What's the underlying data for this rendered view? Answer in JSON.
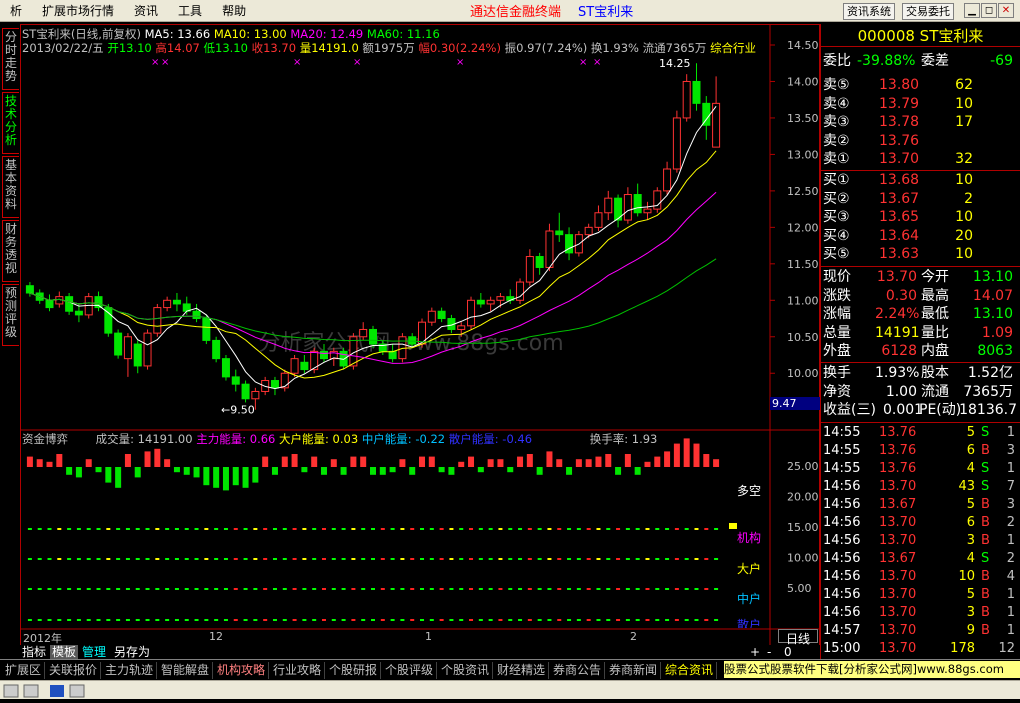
{
  "menu": {
    "items": [
      "析",
      "扩展市场行情",
      "资讯",
      "工具",
      "帮助"
    ],
    "app_title": "通达信金融终端",
    "stock_title": "ST宝利来",
    "btn_news": "资讯系统",
    "btn_trade": "交易委托"
  },
  "left_tabs": [
    "分时走势",
    "技术分析",
    "基本资料",
    "财务透视",
    "预测评级"
  ],
  "chart_header": {
    "name": "ST宝利来(日线,前复权)",
    "ma5": "MA5: 13.66",
    "ma10": "MA10: 13.00",
    "ma20": "MA20: 12.49",
    "ma60": "MA60: 11.16",
    "date": "2013/02/22/五",
    "open": "开13.10",
    "high": "高14.07",
    "low": "低13.10",
    "close": "收13.70",
    "vol": "量14191.0",
    "amount": "额1975万",
    "change": "幅0.30(2.24%)",
    "amplitude": "振0.97(7.24%)",
    "turnover": "换1.93%",
    "float": "流通7365万",
    "industry": "综合行业"
  },
  "price_axis": [
    "14.50",
    "14.00",
    "13.50",
    "13.00",
    "12.50",
    "12.00",
    "11.50",
    "11.00",
    "10.50",
    "10.00"
  ],
  "price_marker": "9.47",
  "annotations": {
    "high": "14.25",
    "low": "9.50"
  },
  "watermark": "分析家公式网 www.88gs.com",
  "lower": {
    "title": "资金博弈",
    "vol": "成交量: 14191.00",
    "main": "主力能量: 0.66",
    "big": "大户能量: 0.03",
    "mid": "中户能量: -0.22",
    "small": "散户能量: -0.46",
    "turnover": "换手率: 1.93",
    "axis": [
      "25.00",
      "20.00",
      "15.00",
      "10.00",
      "5.00"
    ],
    "labels": [
      "多空",
      "机构",
      "大户",
      "中户",
      "散户"
    ]
  },
  "time_axis": [
    "2012年",
    "12",
    "1",
    "2"
  ],
  "period": "日线",
  "sub_tabs": [
    "指标",
    "模板",
    "管理",
    "另存为"
  ],
  "quote": {
    "code_name": "000008 ST宝利来",
    "weibi_label": "委比",
    "weibi": "-39.88%",
    "weicha_label": "委差",
    "weicha": "-69",
    "asks": [
      {
        "label": "卖⑤",
        "price": "13.80",
        "vol": "62"
      },
      {
        "label": "卖④",
        "price": "13.79",
        "vol": "10"
      },
      {
        "label": "卖③",
        "price": "13.78",
        "vol": "17"
      },
      {
        "label": "卖②",
        "price": "13.76",
        "vol": ""
      },
      {
        "label": "卖①",
        "price": "13.70",
        "vol": "32"
      }
    ],
    "bids": [
      {
        "label": "买①",
        "price": "13.68",
        "vol": "10"
      },
      {
        "label": "买②",
        "price": "13.67",
        "vol": "2"
      },
      {
        "label": "买③",
        "price": "13.65",
        "vol": "10"
      },
      {
        "label": "买④",
        "price": "13.64",
        "vol": "20"
      },
      {
        "label": "买⑤",
        "price": "13.63",
        "vol": "10"
      }
    ],
    "stats": [
      {
        "l1": "现价",
        "v1": "13.70",
        "l2": "今开",
        "v2": "13.10"
      },
      {
        "l1": "涨跌",
        "v1": "0.30",
        "l2": "最高",
        "v2": "14.07"
      },
      {
        "l1": "涨幅",
        "v1": "2.24%",
        "l2": "最低",
        "v2": "13.10"
      },
      {
        "l1": "总量",
        "v1": "14191",
        "l2": "量比",
        "v2": "1.09"
      },
      {
        "l1": "外盘",
        "v1": "6128",
        "l2": "内盘",
        "v2": "8063"
      }
    ],
    "stats2": [
      {
        "l1": "换手",
        "v1": "1.93%",
        "l2": "股本",
        "v2": "1.52亿"
      },
      {
        "l1": "净资",
        "v1": "1.00",
        "l2": "流通",
        "v2": "7365万"
      },
      {
        "l1": "收益(三)",
        "v1": "0.001",
        "l2": "PE(动)",
        "v2": "18136.7"
      }
    ],
    "ticks": [
      {
        "t": "14:55",
        "p": "13.76",
        "v": "5",
        "s": "S",
        "n": "1"
      },
      {
        "t": "14:55",
        "p": "13.76",
        "v": "6",
        "s": "B",
        "n": "3"
      },
      {
        "t": "14:55",
        "p": "13.76",
        "v": "4",
        "s": "S",
        "n": "1"
      },
      {
        "t": "14:56",
        "p": "13.70",
        "v": "43",
        "s": "S",
        "n": "7"
      },
      {
        "t": "14:56",
        "p": "13.67",
        "v": "5",
        "s": "B",
        "n": "3"
      },
      {
        "t": "14:56",
        "p": "13.70",
        "v": "6",
        "s": "B",
        "n": "2"
      },
      {
        "t": "14:56",
        "p": "13.70",
        "v": "3",
        "s": "B",
        "n": "1"
      },
      {
        "t": "14:56",
        "p": "13.67",
        "v": "4",
        "s": "S",
        "n": "2"
      },
      {
        "t": "14:56",
        "p": "13.70",
        "v": "10",
        "s": "B",
        "n": "4"
      },
      {
        "t": "14:56",
        "p": "13.70",
        "v": "5",
        "s": "B",
        "n": "1"
      },
      {
        "t": "14:56",
        "p": "13.70",
        "v": "3",
        "s": "B",
        "n": "1"
      },
      {
        "t": "14:57",
        "p": "13.70",
        "v": "9",
        "s": "B",
        "n": "1"
      },
      {
        "t": "15:00",
        "p": "13.70",
        "v": "178",
        "s": "",
        "n": "12"
      }
    ]
  },
  "bottom_tabs": [
    "扩展区",
    "关联报价",
    "主力轨迹",
    "智能解盘",
    "机构攻略",
    "行业攻略",
    "个股研报",
    "个股评级",
    "个股资讯",
    "财经精选",
    "券商公告",
    "券商新闻",
    "综合资讯"
  ],
  "ticker": "股票公式股票软件下载[分析家公式网]www.88gs.com",
  "colors": {
    "up": "#ff3232",
    "down": "#00e600",
    "ma5": "#ffffff",
    "ma10": "#ffff00",
    "ma20": "#ff00ff",
    "ma60": "#00c000"
  },
  "kline": [
    [
      11.2,
      11.25,
      11.05,
      11.1
    ],
    [
      11.1,
      11.15,
      10.95,
      11.0
    ],
    [
      11.0,
      11.08,
      10.85,
      10.9
    ],
    [
      10.95,
      11.12,
      10.9,
      11.05
    ],
    [
      11.05,
      11.1,
      10.8,
      10.85
    ],
    [
      10.85,
      10.95,
      10.7,
      10.8
    ],
    [
      10.8,
      11.1,
      10.75,
      11.05
    ],
    [
      11.05,
      11.12,
      10.85,
      10.9
    ],
    [
      10.9,
      10.95,
      10.5,
      10.55
    ],
    [
      10.55,
      10.6,
      10.2,
      10.25
    ],
    [
      10.2,
      10.55,
      9.95,
      10.5
    ],
    [
      10.4,
      10.45,
      10.0,
      10.1
    ],
    [
      10.1,
      10.6,
      10.05,
      10.55
    ],
    [
      10.55,
      10.95,
      10.5,
      10.9
    ],
    [
      10.9,
      11.05,
      10.85,
      11.0
    ],
    [
      11.0,
      11.1,
      10.85,
      10.95
    ],
    [
      10.95,
      11.05,
      10.8,
      10.85
    ],
    [
      10.85,
      10.95,
      10.7,
      10.75
    ],
    [
      10.75,
      10.8,
      10.4,
      10.45
    ],
    [
      10.45,
      10.5,
      10.15,
      10.2
    ],
    [
      10.2,
      10.25,
      9.9,
      9.95
    ],
    [
      9.95,
      10.05,
      9.75,
      9.85
    ],
    [
      9.85,
      9.9,
      9.6,
      9.65
    ],
    [
      9.65,
      9.8,
      9.5,
      9.75
    ],
    [
      9.75,
      9.95,
      9.7,
      9.9
    ],
    [
      9.9,
      9.95,
      9.7,
      9.8
    ],
    [
      9.8,
      10.05,
      9.75,
      10.0
    ],
    [
      10.0,
      10.25,
      9.95,
      10.2
    ],
    [
      10.15,
      10.25,
      10.0,
      10.05
    ],
    [
      10.05,
      10.35,
      10.0,
      10.3
    ],
    [
      10.3,
      10.4,
      10.15,
      10.2
    ],
    [
      10.2,
      10.35,
      10.1,
      10.3
    ],
    [
      10.3,
      10.35,
      10.05,
      10.1
    ],
    [
      10.1,
      10.55,
      10.05,
      10.5
    ],
    [
      10.5,
      10.7,
      10.45,
      10.6
    ],
    [
      10.6,
      10.65,
      10.35,
      10.4
    ],
    [
      10.4,
      10.45,
      10.25,
      10.3
    ],
    [
      10.3,
      10.4,
      10.15,
      10.2
    ],
    [
      10.2,
      10.55,
      10.15,
      10.5
    ],
    [
      10.5,
      10.55,
      10.35,
      10.4
    ],
    [
      10.4,
      10.75,
      10.35,
      10.7
    ],
    [
      10.7,
      10.9,
      10.65,
      10.85
    ],
    [
      10.85,
      10.9,
      10.7,
      10.75
    ],
    [
      10.75,
      10.8,
      10.55,
      10.6
    ],
    [
      10.6,
      10.7,
      10.5,
      10.65
    ],
    [
      10.65,
      11.05,
      10.6,
      11.0
    ],
    [
      11.0,
      11.1,
      10.9,
      10.95
    ],
    [
      10.95,
      11.05,
      10.85,
      11.0
    ],
    [
      11.0,
      11.1,
      10.9,
      11.05
    ],
    [
      11.05,
      11.15,
      10.95,
      11.0
    ],
    [
      11.0,
      11.3,
      10.95,
      11.25
    ],
    [
      11.25,
      11.7,
      11.2,
      11.6
    ],
    [
      11.6,
      11.65,
      11.35,
      11.45
    ],
    [
      11.45,
      12.05,
      11.4,
      11.95
    ],
    [
      11.95,
      12.2,
      11.8,
      11.9
    ],
    [
      11.9,
      12.0,
      11.55,
      11.65
    ],
    [
      11.65,
      11.95,
      11.6,
      11.9
    ],
    [
      11.9,
      12.05,
      11.85,
      12.0
    ],
    [
      12.0,
      12.3,
      11.95,
      12.2
    ],
    [
      12.2,
      12.5,
      12.1,
      12.4
    ],
    [
      12.4,
      12.45,
      12.0,
      12.1
    ],
    [
      12.1,
      12.55,
      12.05,
      12.45
    ],
    [
      12.45,
      12.6,
      12.15,
      12.2
    ],
    [
      12.2,
      12.35,
      12.1,
      12.25
    ],
    [
      12.25,
      12.55,
      12.2,
      12.5
    ],
    [
      12.5,
      12.9,
      12.45,
      12.8
    ],
    [
      12.8,
      13.6,
      12.75,
      13.5
    ],
    [
      13.5,
      14.1,
      13.45,
      14.0
    ],
    [
      14.0,
      14.25,
      13.6,
      13.7
    ],
    [
      13.7,
      13.8,
      13.2,
      13.4
    ],
    [
      13.1,
      14.07,
      13.1,
      13.7
    ]
  ],
  "vol_bars": [
    [
      4,
      0
    ],
    [
      3,
      0
    ],
    [
      2,
      0
    ],
    [
      5,
      0
    ],
    [
      -3,
      0
    ],
    [
      -4,
      0
    ],
    [
      3,
      0
    ],
    [
      -2,
      0
    ],
    [
      -6,
      0
    ],
    [
      -8,
      0
    ],
    [
      5,
      0
    ],
    [
      -4,
      0
    ],
    [
      6,
      0
    ],
    [
      7,
      0
    ],
    [
      3,
      0
    ],
    [
      -2,
      0
    ],
    [
      -3,
      0
    ],
    [
      -4,
      0
    ],
    [
      -7,
      0
    ],
    [
      -8,
      0
    ],
    [
      -9,
      0
    ],
    [
      -7,
      0
    ],
    [
      -8,
      0
    ],
    [
      -6,
      0
    ],
    [
      4,
      0
    ],
    [
      -3,
      0
    ],
    [
      4,
      0
    ],
    [
      5,
      0
    ],
    [
      -2,
      0
    ],
    [
      4,
      0
    ],
    [
      -3,
      0
    ],
    [
      3,
      0
    ],
    [
      -3,
      0
    ],
    [
      4,
      0
    ],
    [
      4,
      0
    ],
    [
      -3,
      0
    ],
    [
      -3,
      0
    ],
    [
      -2,
      0
    ],
    [
      3,
      0
    ],
    [
      -3,
      0
    ],
    [
      4,
      0
    ],
    [
      4,
      0
    ],
    [
      -2,
      0
    ],
    [
      -3,
      0
    ],
    [
      2,
      0
    ],
    [
      4,
      0
    ],
    [
      -2,
      0
    ],
    [
      3,
      0
    ],
    [
      3,
      0
    ],
    [
      -2,
      0
    ],
    [
      4,
      0
    ],
    [
      5,
      0
    ],
    [
      -3,
      0
    ],
    [
      6,
      0
    ],
    [
      3,
      0
    ],
    [
      -3,
      0
    ],
    [
      3,
      0
    ],
    [
      3,
      0
    ],
    [
      4,
      0
    ],
    [
      5,
      0
    ],
    [
      -3,
      0
    ],
    [
      5,
      0
    ],
    [
      -3,
      0
    ],
    [
      2,
      0
    ],
    [
      4,
      0
    ],
    [
      6,
      0
    ],
    [
      9,
      0
    ],
    [
      11,
      0
    ],
    [
      9,
      0
    ],
    [
      5,
      0
    ],
    [
      3,
      0
    ]
  ]
}
